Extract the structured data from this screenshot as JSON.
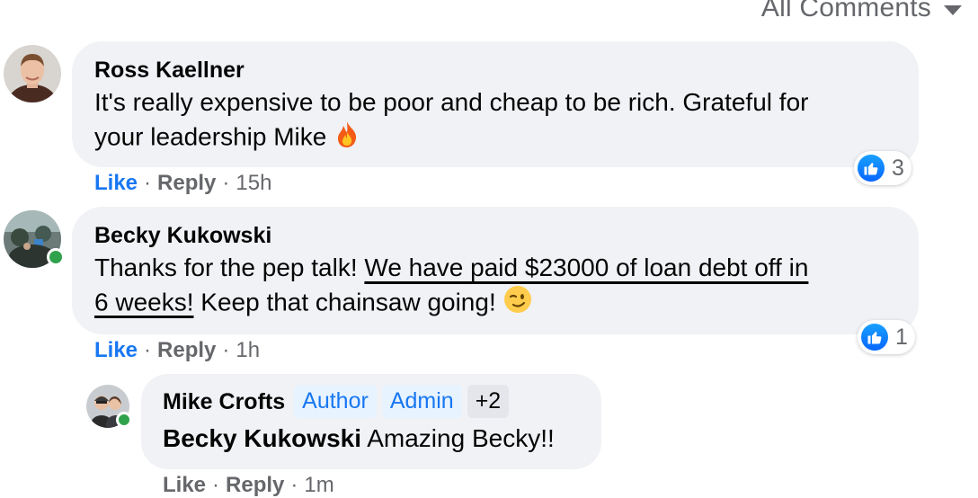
{
  "filter": {
    "label": "All Comments"
  },
  "comments": [
    {
      "author": "Ross Kaellner",
      "text_1": "It's really expensive to be poor and cheap to be rich. Grateful for",
      "text_2": "your leadership Mike",
      "emoji": "fire-emoji",
      "like_label": "Like",
      "reply_label": "Reply",
      "time": "15h",
      "reaction_count": "3",
      "online": false
    },
    {
      "author": "Becky Kukowski",
      "text_pre": "Thanks for the pep talk! ",
      "text_link_1": "We have paid $23000 of loan debt off in",
      "text_link_2": "6 weeks!",
      "text_post": " Keep that chainsaw going!",
      "emoji": "wink-emoji",
      "like_label": "Like",
      "reply_label": "Reply",
      "time": "1h",
      "reaction_count": "1",
      "online": true
    }
  ],
  "reply": {
    "author": "Mike Crofts",
    "badges": [
      "Author",
      "Admin",
      "+2"
    ],
    "tag": "Becky Kukowski",
    "text": "Amazing Becky!!",
    "like_label": "Like",
    "reply_label": "Reply",
    "time": "1m",
    "online": true
  },
  "separator": "·",
  "colors": {
    "accent": "#1877f2",
    "bubble": "#f0f2f5",
    "muted": "#65676b",
    "online": "#31a24c"
  }
}
